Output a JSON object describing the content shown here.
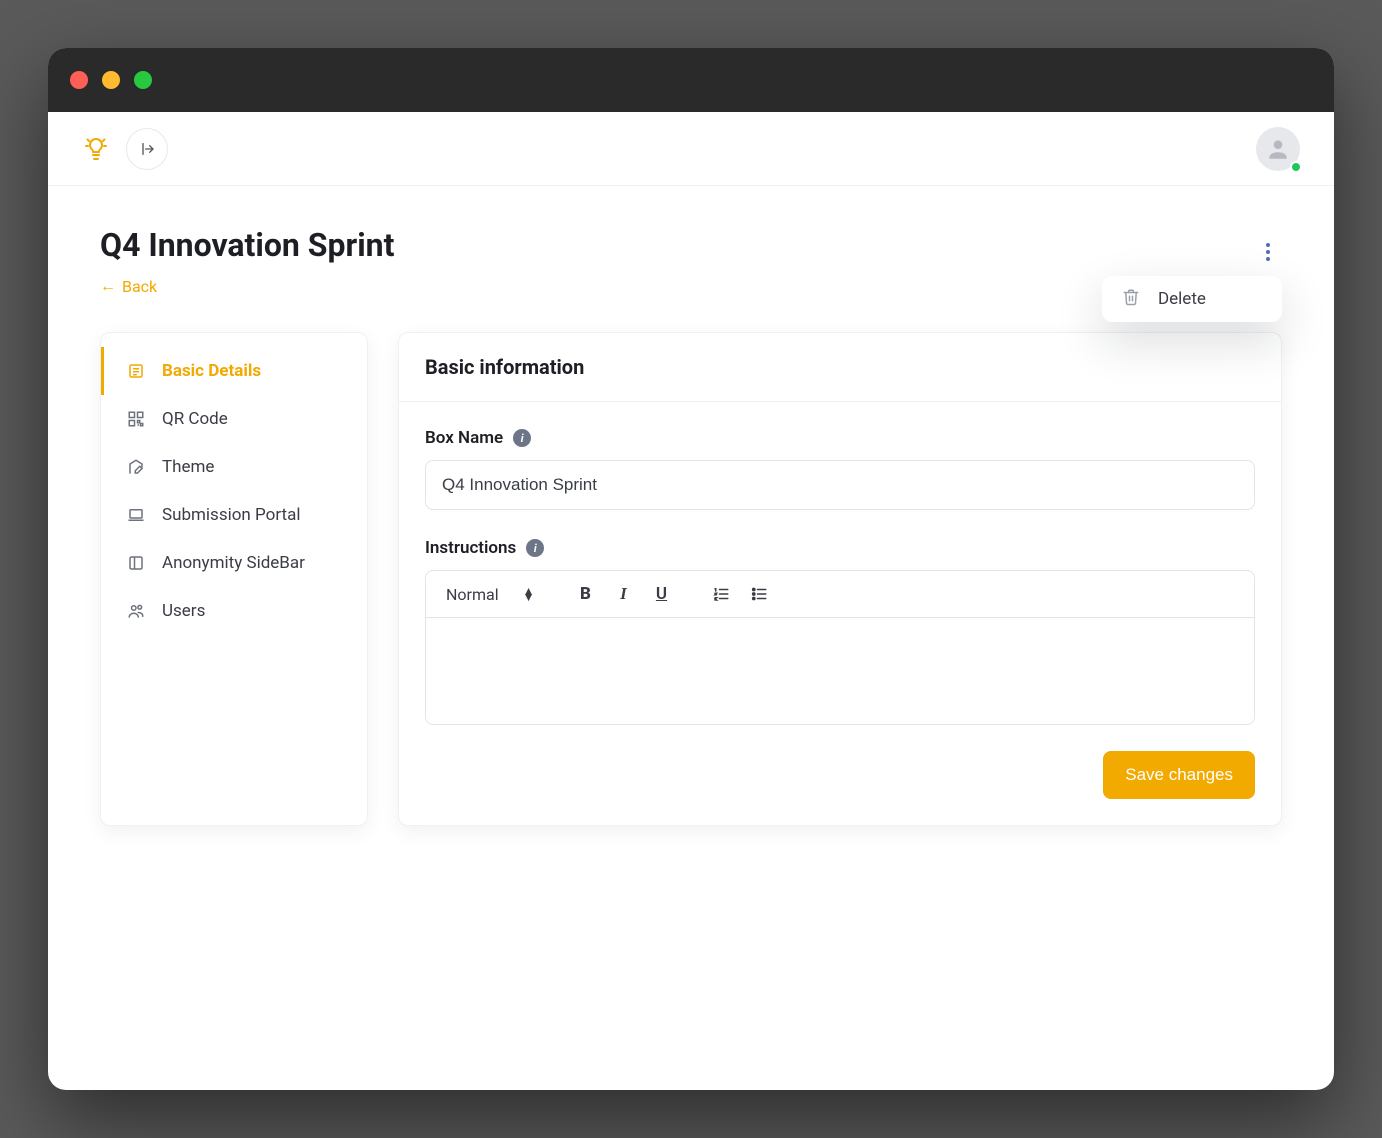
{
  "page": {
    "title": "Q4 Innovation Sprint",
    "back_label": "Back"
  },
  "popover": {
    "delete_label": "Delete"
  },
  "sidebar": {
    "items": [
      {
        "label": "Basic Details"
      },
      {
        "label": "QR Code"
      },
      {
        "label": "Theme"
      },
      {
        "label": "Submission Portal"
      },
      {
        "label": "Anonymity SideBar"
      },
      {
        "label": "Users"
      }
    ]
  },
  "panel": {
    "header": "Basic information",
    "box_name_label": "Box Name",
    "box_name_value": "Q4 Innovation Sprint",
    "instructions_label": "Instructions",
    "format_select": "Normal",
    "save_label": "Save changes"
  }
}
